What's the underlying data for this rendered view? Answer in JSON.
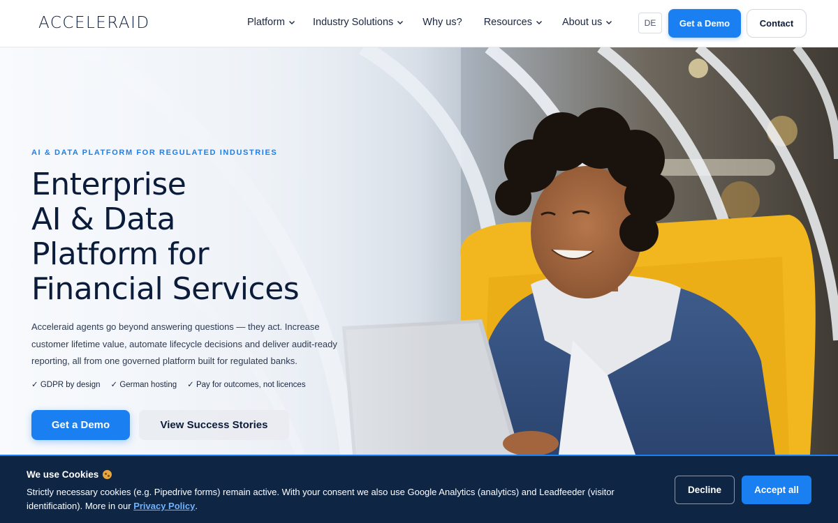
{
  "nav": {
    "logo": "ACCELERAID",
    "menu": [
      {
        "label": "Platform",
        "has_dropdown": true
      },
      {
        "label": "Industry Solutions",
        "has_dropdown": true
      },
      {
        "label": "Why us?",
        "has_dropdown": false
      },
      {
        "label": "Resources",
        "has_dropdown": true
      },
      {
        "label": "About us",
        "has_dropdown": true
      }
    ],
    "language": "DE",
    "demo_button": "Get a Demo",
    "contact_button": "Contact"
  },
  "hero": {
    "eyebrow": "AI & DATA PLATFORM FOR REGULATED INDUSTRIES",
    "headline_lines": [
      "Enterprise",
      "AI & Data",
      "Platform for",
      "Financial Services"
    ],
    "lead": "Acceleraid agents go beyond answering questions — they act. Increase customer lifetime value, automate lifecycle decisions and deliver audit-ready reporting, all from one governed platform built for regulated banks.",
    "checks": [
      "✓ GDPR by design",
      "✓ German hosting",
      "✓ Pay for outcomes, not licences"
    ],
    "primary_button": "Get a Demo",
    "secondary_button": "View Success Stories"
  },
  "cookie": {
    "title": "We use Cookies",
    "text_before_link": "Strictly necessary cookies (e.g. Pipedrive forms) remain active. With your consent we also use Google Analytics (analytics) and Leadfeeder (visitor identification). More in our ",
    "link_text": "Privacy Policy",
    "text_after_link": ".",
    "decline_button": "Decline",
    "accept_button": "Accept all"
  },
  "colors": {
    "accent": "#1a7ff0",
    "navy": "#0b1b3a",
    "cookie_bg": "#0e2544",
    "link": "#6fb3ff",
    "chair_yellow": "#f2b71e"
  }
}
